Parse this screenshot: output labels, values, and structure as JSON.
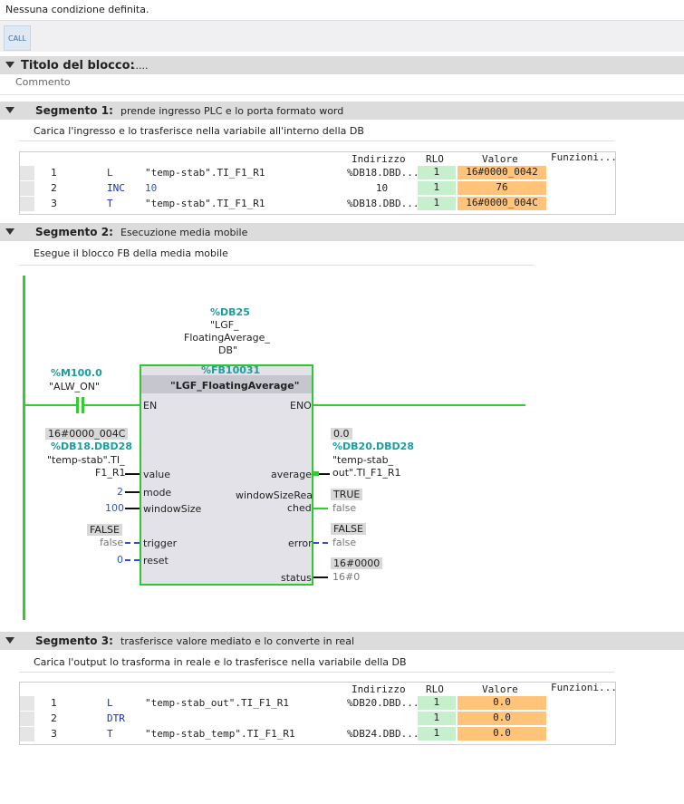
{
  "top_message": "Nessuna condizione definita.",
  "call_button": "CALL",
  "block": {
    "title_label": "Titolo del blocco:",
    "title_value": ".....",
    "comment": "Commento"
  },
  "table_headers": {
    "indirizzo": "Indirizzo",
    "rlo": "RLO",
    "valore": "Valore",
    "funzioni": "Funzioni..."
  },
  "seg1": {
    "title": "Segmento 1:",
    "desc": "prende ingresso PLC e lo porta formato word",
    "comment": "Carica l'ingresso e lo trasferisce nella variabile all'interno della DB",
    "rows": [
      {
        "n": "1",
        "op": "L",
        "arg": "\"temp-stab\".TI_F1_R1",
        "addr": "%DB18.DBD...",
        "rlo": "1",
        "val": "16#0000_0042"
      },
      {
        "n": "2",
        "op": "INC",
        "arg": "10",
        "addr": "10",
        "rlo": "1",
        "val": "76"
      },
      {
        "n": "3",
        "op": "T",
        "arg": "\"temp-stab\".TI_F1_R1",
        "addr": "%DB18.DBD...",
        "rlo": "1",
        "val": "16#0000_004C"
      }
    ]
  },
  "seg2": {
    "title": "Segmento 2:",
    "desc": "Esecuzione media mobile",
    "comment": "Esegue il blocco FB della media mobile",
    "contact_addr": "%M100.0",
    "contact_name": "\"ALW_ON\"",
    "db_addr": "%DB25",
    "db_name1": "\"LGF_",
    "db_name2": "FloatingAverage_",
    "db_name3": "DB\"",
    "fb_addr": "%FB10031",
    "fb_name": "\"LGF_FloatingAverage\"",
    "pins": {
      "en": "EN",
      "eno": "ENO",
      "value": "value",
      "mode": "mode",
      "windowsize": "windowSize",
      "trigger": "trigger",
      "reset": "reset",
      "average": "average",
      "wsr1": "windowSizeRea",
      "wsr2": "ched",
      "error": "error",
      "status": "status"
    },
    "value_in": {
      "monitor": "16#0000_004C",
      "addr": "%DB18.DBD28",
      "name1": "\"temp-stab\".TI_",
      "name2": "F1_R1"
    },
    "mode_in": "2",
    "windowsize_in": "100",
    "trigger_in": {
      "monitor": "FALSE",
      "value": "false"
    },
    "reset_in": "0",
    "average_out": {
      "monitor": "0.0",
      "addr": "%DB20.DBD28",
      "name1": "\"temp-stab_",
      "name2": "out\".TI_F1_R1"
    },
    "wsr_out": {
      "monitor": "TRUE",
      "value": "false"
    },
    "error_out": {
      "monitor": "FALSE",
      "value": "false"
    },
    "status_out": {
      "monitor": "16#0000",
      "value": "16#0"
    }
  },
  "seg3": {
    "title": "Segmento 3:",
    "desc": "trasferisce valore mediato e lo converte in real",
    "comment": "Carica l'output lo trasforma in reale e lo trasferisce nella variabile della DB",
    "rows": [
      {
        "n": "1",
        "op": "L",
        "arg": "\"temp-stab_out\".TI_F1_R1",
        "addr": "%DB20.DBD...",
        "rlo": "1",
        "val": "0.0"
      },
      {
        "n": "2",
        "op": "DTR",
        "arg": "",
        "addr": "",
        "rlo": "1",
        "val": "0.0"
      },
      {
        "n": "3",
        "op": "T",
        "arg": "\"temp-stab_temp\".TI_F1_R1",
        "addr": "%DB24.DBD...",
        "rlo": "1",
        "val": "0.0"
      }
    ]
  }
}
